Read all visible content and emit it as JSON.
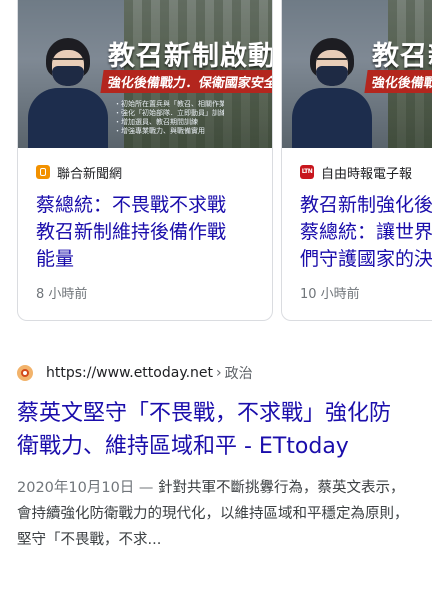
{
  "news_cards": [
    {
      "image": {
        "title": "教召新制啟動",
        "subtitle": "強化後備戰力．保衛國家安全！",
        "lines": [
          "・初始所在置兵與「教召、相關作業及守備陣位」",
          "・強化「初始部隊．立即動員」訓練",
          "・增加選員、教召期間訓練",
          "・增強專業戰力、與戰備實用"
        ]
      },
      "source": "聯合新聞網",
      "source_icon": "udn-logo-icon",
      "headline_lines": [
        "蔡總統：不畏戰不求戰",
        "教召新制維持後備作戰",
        "能量"
      ],
      "time": "8 小時前"
    },
    {
      "image": {
        "title": "教召新制啟動",
        "subtitle": "強化後備戰力．保衛國"
      },
      "source": "自由時報電子報",
      "source_icon": "ltn-logo-icon",
      "source_icon_text": "LTN",
      "headline_lines": [
        "教召新制強化後",
        "蔡總統：讓世界",
        "們守護國家的決"
      ],
      "time": "10 小時前"
    }
  ],
  "result": {
    "url": "https://www.ettoday.net",
    "separator": "›",
    "breadcrumb": "政治",
    "title": "蔡英文堅守「不畏戰，不求戰」強化防衛戰力、維持區域和平 - ETtoday",
    "date": "2020年10月10日",
    "dash": " — ",
    "snippet": "針對共軍不斷挑釁行為，蔡英文表示，會持續強化防衛戰力的現代化，以維持區域和平穩定為原則，堅守「不畏戰，不求..."
  },
  "colors": {
    "link": "#1a0dab",
    "meta": "#70757a",
    "border": "#dadce0"
  }
}
